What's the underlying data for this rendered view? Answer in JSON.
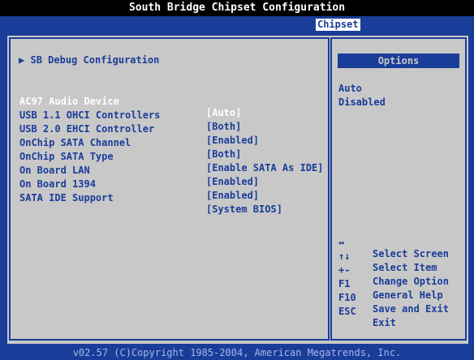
{
  "window": {
    "title": "South Bridge Chipset Configuration"
  },
  "tabs": [
    {
      "label": "Chipset",
      "active": true
    }
  ],
  "submenu": {
    "arrow": "▶",
    "label": "SB Debug Configuration"
  },
  "settings": [
    {
      "label": "AC97 Audio Device",
      "value": "[Auto]",
      "selected": true
    },
    {
      "label": "USB 1.1 OHCI Controllers",
      "value": "[Both]"
    },
    {
      "label": "USB 2.0 EHCI Controller",
      "value": "[Enabled]"
    },
    {
      "label": "OnChip SATA Channel",
      "value": "[Both]"
    },
    {
      "label": "OnChip SATA Type",
      "value": "[Enable SATA As IDE]"
    },
    {
      "label": "On Board LAN",
      "value": "[Enabled]"
    },
    {
      "label": "On Board 1394",
      "value": "[Enabled]"
    },
    {
      "label": "SATA IDE Support",
      "value": "[System BIOS]"
    }
  ],
  "options_panel": {
    "title": "Options",
    "items": [
      "Auto",
      "Disabled"
    ]
  },
  "help": [
    {
      "key": "↔",
      "desc": "Select Screen",
      "icon": "left-right-arrow-icon"
    },
    {
      "key": "↑↓",
      "desc": "Select Item",
      "icon": "up-down-arrow-icon"
    },
    {
      "key": "+-",
      "desc": "Change Option",
      "icon": "plus-minus-icon"
    },
    {
      "key": "F1",
      "desc": "General Help"
    },
    {
      "key": "F10",
      "desc": "Save and Exit"
    },
    {
      "key": "ESC",
      "desc": "Exit"
    }
  ],
  "footer": {
    "text": "v02.57 (C)Copyright 1985-2004, American Megatrends, Inc."
  },
  "colors": {
    "background": "#1a3d99",
    "panel": "#c8c8c8",
    "text": "#1a3d99",
    "selected_text": "#ffffff",
    "titlebar": "#000000"
  }
}
